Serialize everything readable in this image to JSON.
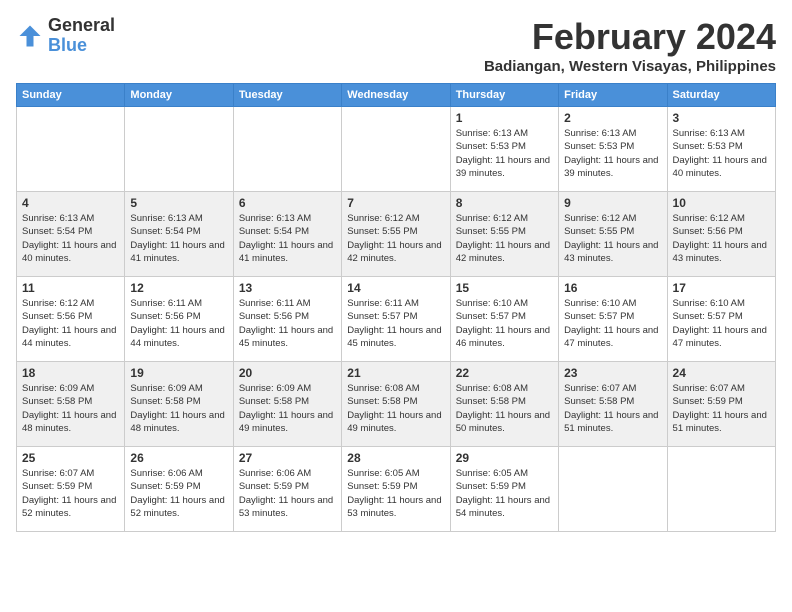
{
  "logo": {
    "general": "General",
    "blue": "Blue"
  },
  "title": {
    "month": "February 2024",
    "location": "Badiangan, Western Visayas, Philippines"
  },
  "headers": [
    "Sunday",
    "Monday",
    "Tuesday",
    "Wednesday",
    "Thursday",
    "Friday",
    "Saturday"
  ],
  "weeks": [
    [
      {
        "day": "",
        "info": ""
      },
      {
        "day": "",
        "info": ""
      },
      {
        "day": "",
        "info": ""
      },
      {
        "day": "",
        "info": ""
      },
      {
        "day": "1",
        "sunrise": "Sunrise: 6:13 AM",
        "sunset": "Sunset: 5:53 PM",
        "daylight": "Daylight: 11 hours and 39 minutes."
      },
      {
        "day": "2",
        "sunrise": "Sunrise: 6:13 AM",
        "sunset": "Sunset: 5:53 PM",
        "daylight": "Daylight: 11 hours and 39 minutes."
      },
      {
        "day": "3",
        "sunrise": "Sunrise: 6:13 AM",
        "sunset": "Sunset: 5:53 PM",
        "daylight": "Daylight: 11 hours and 40 minutes."
      }
    ],
    [
      {
        "day": "4",
        "sunrise": "Sunrise: 6:13 AM",
        "sunset": "Sunset: 5:54 PM",
        "daylight": "Daylight: 11 hours and 40 minutes."
      },
      {
        "day": "5",
        "sunrise": "Sunrise: 6:13 AM",
        "sunset": "Sunset: 5:54 PM",
        "daylight": "Daylight: 11 hours and 41 minutes."
      },
      {
        "day": "6",
        "sunrise": "Sunrise: 6:13 AM",
        "sunset": "Sunset: 5:54 PM",
        "daylight": "Daylight: 11 hours and 41 minutes."
      },
      {
        "day": "7",
        "sunrise": "Sunrise: 6:12 AM",
        "sunset": "Sunset: 5:55 PM",
        "daylight": "Daylight: 11 hours and 42 minutes."
      },
      {
        "day": "8",
        "sunrise": "Sunrise: 6:12 AM",
        "sunset": "Sunset: 5:55 PM",
        "daylight": "Daylight: 11 hours and 42 minutes."
      },
      {
        "day": "9",
        "sunrise": "Sunrise: 6:12 AM",
        "sunset": "Sunset: 5:55 PM",
        "daylight": "Daylight: 11 hours and 43 minutes."
      },
      {
        "day": "10",
        "sunrise": "Sunrise: 6:12 AM",
        "sunset": "Sunset: 5:56 PM",
        "daylight": "Daylight: 11 hours and 43 minutes."
      }
    ],
    [
      {
        "day": "11",
        "sunrise": "Sunrise: 6:12 AM",
        "sunset": "Sunset: 5:56 PM",
        "daylight": "Daylight: 11 hours and 44 minutes."
      },
      {
        "day": "12",
        "sunrise": "Sunrise: 6:11 AM",
        "sunset": "Sunset: 5:56 PM",
        "daylight": "Daylight: 11 hours and 44 minutes."
      },
      {
        "day": "13",
        "sunrise": "Sunrise: 6:11 AM",
        "sunset": "Sunset: 5:56 PM",
        "daylight": "Daylight: 11 hours and 45 minutes."
      },
      {
        "day": "14",
        "sunrise": "Sunrise: 6:11 AM",
        "sunset": "Sunset: 5:57 PM",
        "daylight": "Daylight: 11 hours and 45 minutes."
      },
      {
        "day": "15",
        "sunrise": "Sunrise: 6:10 AM",
        "sunset": "Sunset: 5:57 PM",
        "daylight": "Daylight: 11 hours and 46 minutes."
      },
      {
        "day": "16",
        "sunrise": "Sunrise: 6:10 AM",
        "sunset": "Sunset: 5:57 PM",
        "daylight": "Daylight: 11 hours and 47 minutes."
      },
      {
        "day": "17",
        "sunrise": "Sunrise: 6:10 AM",
        "sunset": "Sunset: 5:57 PM",
        "daylight": "Daylight: 11 hours and 47 minutes."
      }
    ],
    [
      {
        "day": "18",
        "sunrise": "Sunrise: 6:09 AM",
        "sunset": "Sunset: 5:58 PM",
        "daylight": "Daylight: 11 hours and 48 minutes."
      },
      {
        "day": "19",
        "sunrise": "Sunrise: 6:09 AM",
        "sunset": "Sunset: 5:58 PM",
        "daylight": "Daylight: 11 hours and 48 minutes."
      },
      {
        "day": "20",
        "sunrise": "Sunrise: 6:09 AM",
        "sunset": "Sunset: 5:58 PM",
        "daylight": "Daylight: 11 hours and 49 minutes."
      },
      {
        "day": "21",
        "sunrise": "Sunrise: 6:08 AM",
        "sunset": "Sunset: 5:58 PM",
        "daylight": "Daylight: 11 hours and 49 minutes."
      },
      {
        "day": "22",
        "sunrise": "Sunrise: 6:08 AM",
        "sunset": "Sunset: 5:58 PM",
        "daylight": "Daylight: 11 hours and 50 minutes."
      },
      {
        "day": "23",
        "sunrise": "Sunrise: 6:07 AM",
        "sunset": "Sunset: 5:58 PM",
        "daylight": "Daylight: 11 hours and 51 minutes."
      },
      {
        "day": "24",
        "sunrise": "Sunrise: 6:07 AM",
        "sunset": "Sunset: 5:59 PM",
        "daylight": "Daylight: 11 hours and 51 minutes."
      }
    ],
    [
      {
        "day": "25",
        "sunrise": "Sunrise: 6:07 AM",
        "sunset": "Sunset: 5:59 PM",
        "daylight": "Daylight: 11 hours and 52 minutes."
      },
      {
        "day": "26",
        "sunrise": "Sunrise: 6:06 AM",
        "sunset": "Sunset: 5:59 PM",
        "daylight": "Daylight: 11 hours and 52 minutes."
      },
      {
        "day": "27",
        "sunrise": "Sunrise: 6:06 AM",
        "sunset": "Sunset: 5:59 PM",
        "daylight": "Daylight: 11 hours and 53 minutes."
      },
      {
        "day": "28",
        "sunrise": "Sunrise: 6:05 AM",
        "sunset": "Sunset: 5:59 PM",
        "daylight": "Daylight: 11 hours and 53 minutes."
      },
      {
        "day": "29",
        "sunrise": "Sunrise: 6:05 AM",
        "sunset": "Sunset: 5:59 PM",
        "daylight": "Daylight: 11 hours and 54 minutes."
      },
      {
        "day": "",
        "info": ""
      },
      {
        "day": "",
        "info": ""
      }
    ]
  ]
}
